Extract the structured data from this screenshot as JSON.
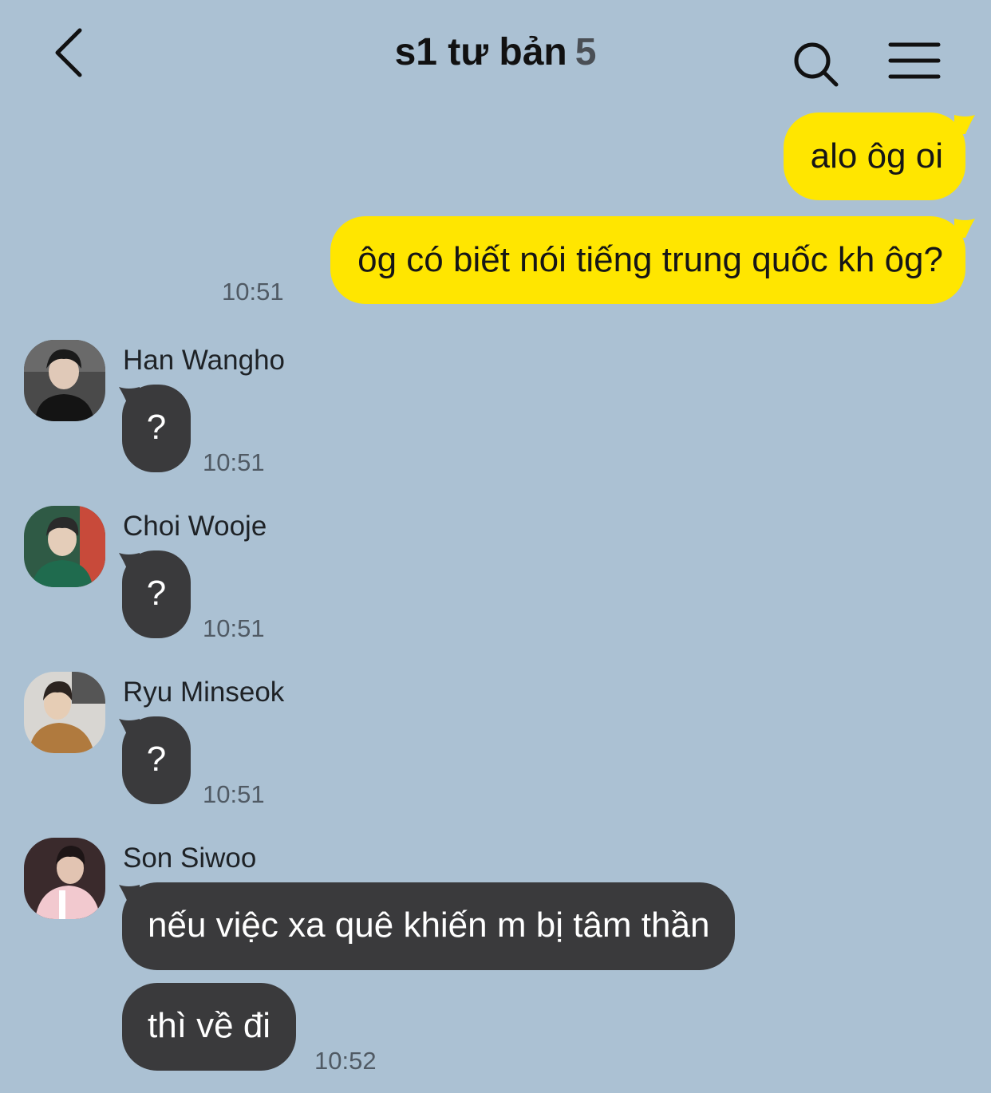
{
  "header": {
    "title": "s1 tư bản",
    "member_count": "5",
    "back_icon": "chevron-left-icon",
    "search_icon": "search-icon",
    "menu_icon": "hamburger-menu-icon"
  },
  "colors": {
    "background": "#abc1d3",
    "outgoing_bubble": "#ffe600",
    "incoming_bubble": "#3a3a3c"
  },
  "outgoing": [
    {
      "text": "alo ôg oi"
    },
    {
      "text": "ôg có biết nói tiếng trung quốc kh ôg?",
      "time": "10:51"
    }
  ],
  "incoming": [
    {
      "sender": "Han Wangho",
      "messages": [
        {
          "text": "?"
        }
      ],
      "time": "10:51"
    },
    {
      "sender": "Choi Wooje",
      "messages": [
        {
          "text": "?"
        }
      ],
      "time": "10:51"
    },
    {
      "sender": "Ryu Minseok",
      "messages": [
        {
          "text": "?"
        }
      ],
      "time": "10:51"
    },
    {
      "sender": "Son Siwoo",
      "messages": [
        {
          "text": "nếu việc xa quê khiến m bị tâm thần"
        },
        {
          "text": "thì về đi"
        }
      ],
      "time": "10:52"
    }
  ]
}
